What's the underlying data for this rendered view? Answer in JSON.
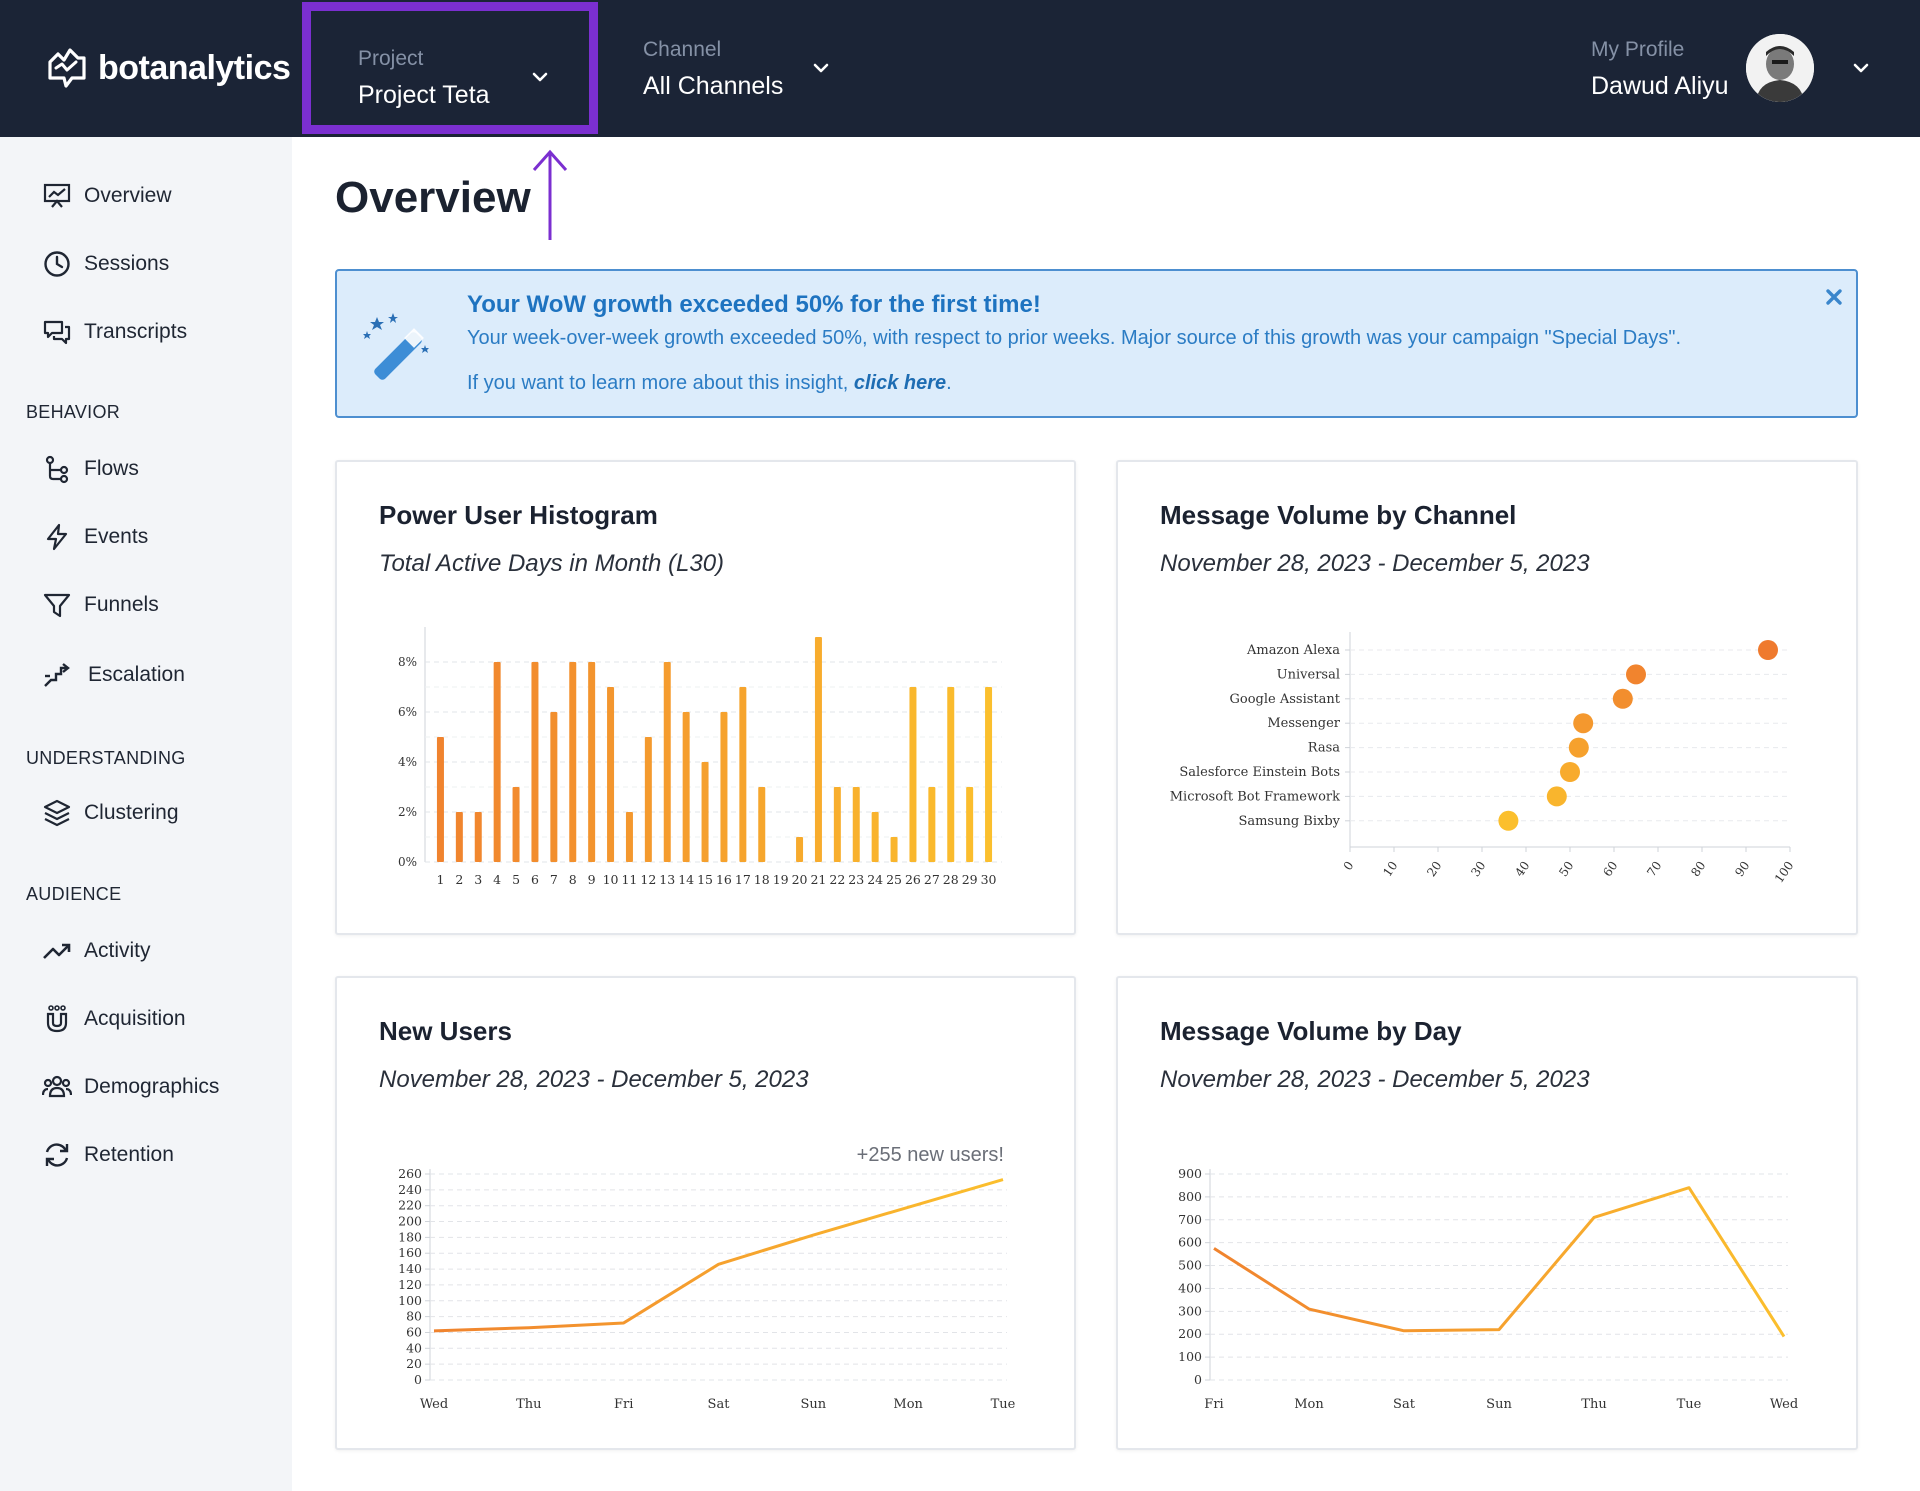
{
  "brand": {
    "name": "botanalytics"
  },
  "header": {
    "project": {
      "label": "Project",
      "value": "Project Teta"
    },
    "channel": {
      "label": "Channel",
      "value": "All Channels"
    },
    "profile": {
      "label": "My Profile",
      "value": "Dawud Aliyu"
    }
  },
  "sidebar": {
    "top_items": [
      {
        "label": "Overview",
        "icon": "presentation-chart-icon"
      },
      {
        "label": "Sessions",
        "icon": "clock-icon"
      },
      {
        "label": "Transcripts",
        "icon": "chat-bubbles-icon"
      }
    ],
    "sections": [
      {
        "title": "BEHAVIOR",
        "items": [
          {
            "label": "Flows",
            "icon": "flow-icon"
          },
          {
            "label": "Events",
            "icon": "lightning-icon"
          },
          {
            "label": "Funnels",
            "icon": "funnel-icon"
          },
          {
            "label": "Escalation",
            "icon": "escalation-icon"
          }
        ]
      },
      {
        "title": "UNDERSTANDING",
        "items": [
          {
            "label": "Clustering",
            "icon": "layers-icon"
          }
        ]
      },
      {
        "title": "AUDIENCE",
        "items": [
          {
            "label": "Activity",
            "icon": "trend-up-icon"
          },
          {
            "label": "Acquisition",
            "icon": "magnet-icon"
          },
          {
            "label": "Demographics",
            "icon": "users-icon"
          },
          {
            "label": "Retention",
            "icon": "refresh-icon"
          }
        ]
      }
    ]
  },
  "page": {
    "title": "Overview"
  },
  "insight": {
    "title": "Your WoW growth exceeded 50% for the first time!",
    "body": "Your week-over-week growth exceeded 50%, with respect to prior weeks. Major source of this growth was your campaign \"Special Days\".",
    "link_prefix": "If you want to learn more about this insight, ",
    "link_text": "click here",
    "link_suffix": ".",
    "icon": "magic-wand-icon"
  },
  "cards": {
    "power_user": {
      "title": "Power User Histogram",
      "subtitle": "Total Active Days in Month (L30)"
    },
    "msg_channel": {
      "title": "Message Volume by Channel",
      "subtitle": "November 28, 2023 - December 5, 2023"
    },
    "new_users": {
      "title": "New Users",
      "subtitle": "November 28, 2023 - December 5, 2023",
      "annotation": "+255 new users!"
    },
    "msg_day": {
      "title": "Message Volume by Day",
      "subtitle": "November 28, 2023 - December 5, 2023"
    }
  },
  "colors": {
    "topbar": "#1b2436",
    "highlight": "#7b2fd0",
    "orange": "#f0832e",
    "yellow": "#fbbf2d"
  },
  "chart_data": [
    {
      "type": "bar",
      "title": "Power User Histogram",
      "categories": [
        "1",
        "2",
        "3",
        "4",
        "5",
        "6",
        "7",
        "8",
        "9",
        "10",
        "11",
        "12",
        "13",
        "14",
        "15",
        "16",
        "17",
        "18",
        "19",
        "20",
        "21",
        "22",
        "23",
        "24",
        "25",
        "26",
        "27",
        "28",
        "29",
        "30"
      ],
      "values": [
        5,
        2,
        2,
        8,
        3,
        8,
        6,
        8,
        8,
        7,
        2,
        5,
        8,
        6,
        4,
        6,
        7,
        3,
        0,
        1,
        9,
        3,
        3,
        2,
        1,
        7,
        3,
        7,
        3,
        7
      ],
      "ylim": [
        0,
        9
      ],
      "yticks": [
        "0%",
        "2%",
        "4%",
        "6%",
        "8%"
      ],
      "ytick_values": [
        0,
        2,
        4,
        6,
        8
      ],
      "grid": true
    },
    {
      "type": "scatter",
      "title": "Message Volume by Channel",
      "categories": [
        "Amazon Alexa",
        "Universal",
        "Google Assistant",
        "Messenger",
        "Rasa",
        "Salesforce Einstein Bots",
        "Microsoft Bot Framework",
        "Samsung Bixby"
      ],
      "values": [
        95,
        65,
        62,
        53,
        52,
        50,
        47,
        36
      ],
      "xlim": [
        0,
        100
      ],
      "xticks": [
        "0",
        "10",
        "20",
        "30",
        "40",
        "50",
        "60",
        "70",
        "80",
        "90",
        "100"
      ],
      "grid": true
    },
    {
      "type": "line",
      "title": "New Users",
      "categories": [
        "Wed",
        "Thu",
        "Fri",
        "Sat",
        "Sun",
        "Mon",
        "Tue"
      ],
      "values": [
        62,
        66,
        72,
        146,
        183,
        218,
        253
      ],
      "ylim": [
        0,
        260
      ],
      "yticks": [
        "0",
        "20",
        "40",
        "60",
        "80",
        "100",
        "120",
        "140",
        "160",
        "180",
        "200",
        "220",
        "240",
        "260"
      ],
      "grid": true
    },
    {
      "type": "line",
      "title": "Message Volume by Day",
      "categories": [
        "Fri",
        "Mon",
        "Sat",
        "Sun",
        "Thu",
        "Tue",
        "Wed"
      ],
      "values": [
        575,
        310,
        215,
        220,
        710,
        840,
        190
      ],
      "ylim": [
        0,
        900
      ],
      "yticks": [
        "0",
        "100",
        "200",
        "300",
        "400",
        "500",
        "600",
        "700",
        "800",
        "900"
      ],
      "grid": true
    }
  ]
}
